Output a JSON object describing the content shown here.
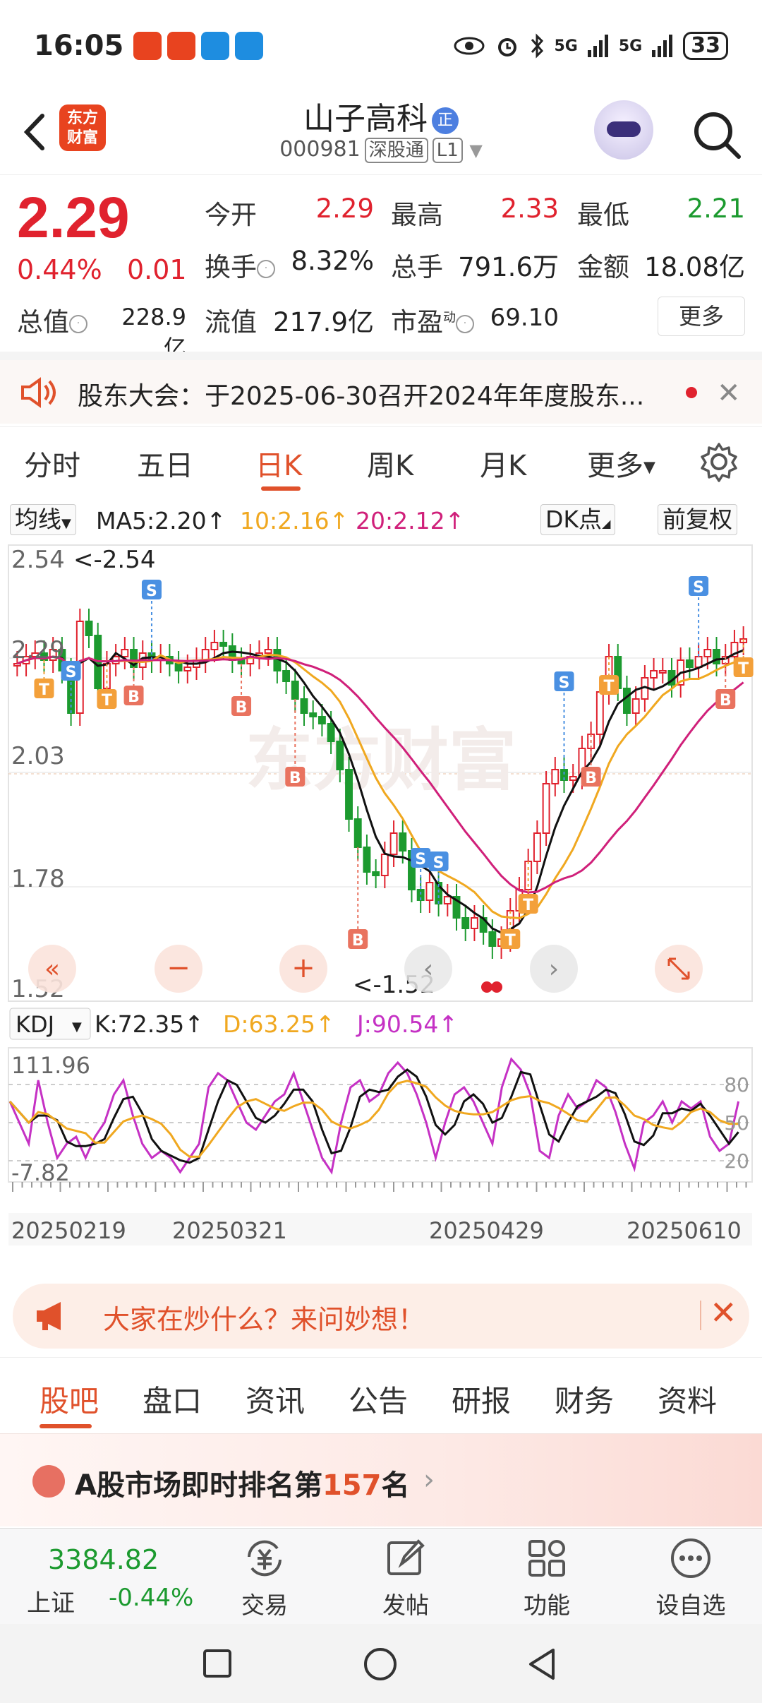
{
  "status_bar": {
    "time": "16:05",
    "network1": "5G",
    "network2": "5G",
    "battery": "33"
  },
  "header": {
    "stock_name": "山子高科",
    "badge": "正",
    "stock_code": "000981",
    "tag1": "深股通",
    "tag2": "L1",
    "logo_line1": "东方",
    "logo_line2": "财富"
  },
  "quote": {
    "price": "2.29",
    "change_pct": "0.44%",
    "change": "0.01",
    "open_label": "今开",
    "open": "2.29",
    "high_label": "最高",
    "high": "2.33",
    "low_label": "最低",
    "low": "2.21",
    "turnover_label": "换手",
    "turnover": "8.32%",
    "volume_label": "总手",
    "volume": "791.6万",
    "amount_label": "金额",
    "amount": "18.08亿",
    "mcap_label": "总值",
    "mcap": "228.9亿",
    "float_label": "流值",
    "float_cap": "217.9亿",
    "pe_label": "市盈",
    "pe_sup": "动",
    "pe": "69.10",
    "more": "更多"
  },
  "notice": {
    "text": "股东大会：于2025-06-30召开2024年年度股东..."
  },
  "period_tabs": [
    "分时",
    "五日",
    "日K",
    "周K",
    "月K",
    "更多"
  ],
  "ma_legend": {
    "selector": "均线",
    "ma5": "MA5:2.20↑",
    "ma10": "10:2.16↑",
    "ma20": "20:2.12↑",
    "dk": "DK点",
    "adjust": "前复权"
  },
  "kline": {
    "y_labels": [
      "2.54",
      "2.29",
      "2.03",
      "1.78",
      "1.52"
    ],
    "max_label": "<-2.54",
    "min_label": "<-1.52",
    "watermark": "东方财富"
  },
  "kdj": {
    "selector": "KDJ",
    "k": "K:72.35↑",
    "d": "D:63.25↑",
    "j": "J:90.54↑",
    "y_top": "111.96",
    "y_bottom": "-7.82",
    "right_labels": [
      "80",
      "50",
      "20"
    ]
  },
  "x_dates": [
    "20250219",
    "20250321",
    "20250429",
    "20250610"
  ],
  "colors": {
    "up": "#e0222e",
    "down": "#1c9a2f",
    "accent": "#e0512b",
    "ma5": "#111111",
    "ma10": "#f0a820",
    "ma20": "#d0207a"
  },
  "ask_banner": {
    "text": "大家在炒什么？来问妙想！"
  },
  "news_tabs": [
    "股吧",
    "盘口",
    "资讯",
    "公告",
    "研报",
    "财务",
    "资料"
  ],
  "rank": {
    "prefix": "A股市场即时排名第",
    "number": "157",
    "suffix": "名"
  },
  "index": {
    "value": "3384.82",
    "name": "上证",
    "pct": "-0.44%"
  },
  "toolbar": [
    {
      "label": "交易",
      "icon": "yuan-exchange-icon"
    },
    {
      "label": "发帖",
      "icon": "edit-icon"
    },
    {
      "label": "功能",
      "icon": "grid-icon"
    },
    {
      "label": "设自选",
      "icon": "more-dots-icon"
    }
  ]
}
